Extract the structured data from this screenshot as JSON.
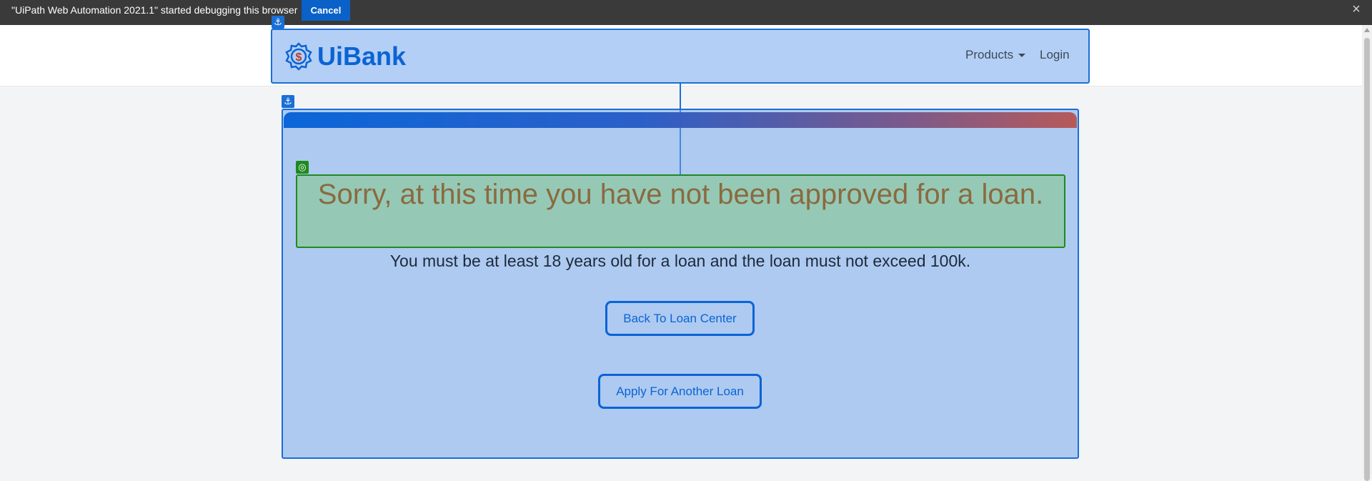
{
  "debug_bar": {
    "message": "\"UiPath Web Automation 2021.1\" started debugging this browser",
    "cancel_label": "Cancel",
    "close_icon": "close-icon"
  },
  "header": {
    "logo_text": "UiBank",
    "logo_icon": "dollar-gear-icon",
    "nav": {
      "products_label": "Products",
      "login_label": "Login"
    }
  },
  "main": {
    "heading": "Sorry, at this time you have not been approved for a loan.",
    "message": "You must be at least 18 years old for a loan and the loan must not exceed 100k.",
    "back_button_label": "Back To Loan Center",
    "apply_button_label": "Apply For Another Loan"
  },
  "overlay": {
    "anchor_icon": "anchor-icon",
    "target_icon": "target-icon"
  },
  "colors": {
    "brand": "#0a64d4",
    "heading": "#8a6a3f",
    "highlight_anchor": "#1a6fd6",
    "highlight_target": "#1e8a1e"
  }
}
